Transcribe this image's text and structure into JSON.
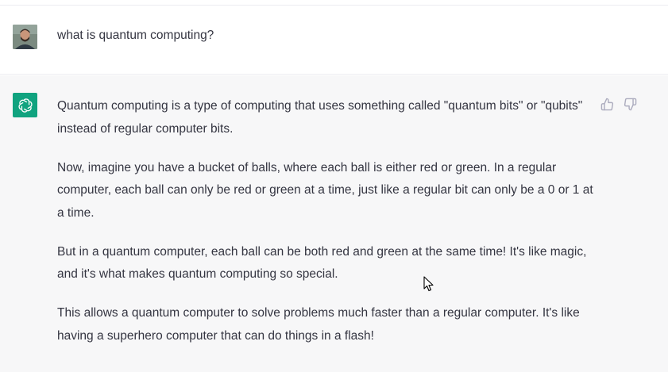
{
  "conversation": {
    "user_message": "what is quantum computing?",
    "assistant_paragraphs": [
      "Quantum computing is a type of computing that uses something called \"quantum bits\" or \"qubits\" instead of regular computer bits.",
      "Now, imagine you have a bucket of balls, where each ball is either red or green. In a regular computer, each ball can only be red or green at a time, just like a regular bit can only be a 0 or 1 at a time.",
      "But in a quantum computer, each ball can be both red and green at the same time! It's like magic, and it's what makes quantum computing so special.",
      "This allows a quantum computer to solve problems much faster than a regular computer. It's like having a superhero computer that can do things in a flash!"
    ]
  },
  "icons": {
    "user_avatar": "user-avatar-photo",
    "assistant_logo": "chatgpt-logo-icon",
    "thumbs_up": "thumbs-up-icon",
    "thumbs_down": "thumbs-down-icon",
    "cursor": "mouse-pointer-icon"
  },
  "colors": {
    "assistant_bg": "#f7f7f8",
    "logo_bg": "#10a37f",
    "text": "#343541",
    "divider": "#ececf1"
  }
}
